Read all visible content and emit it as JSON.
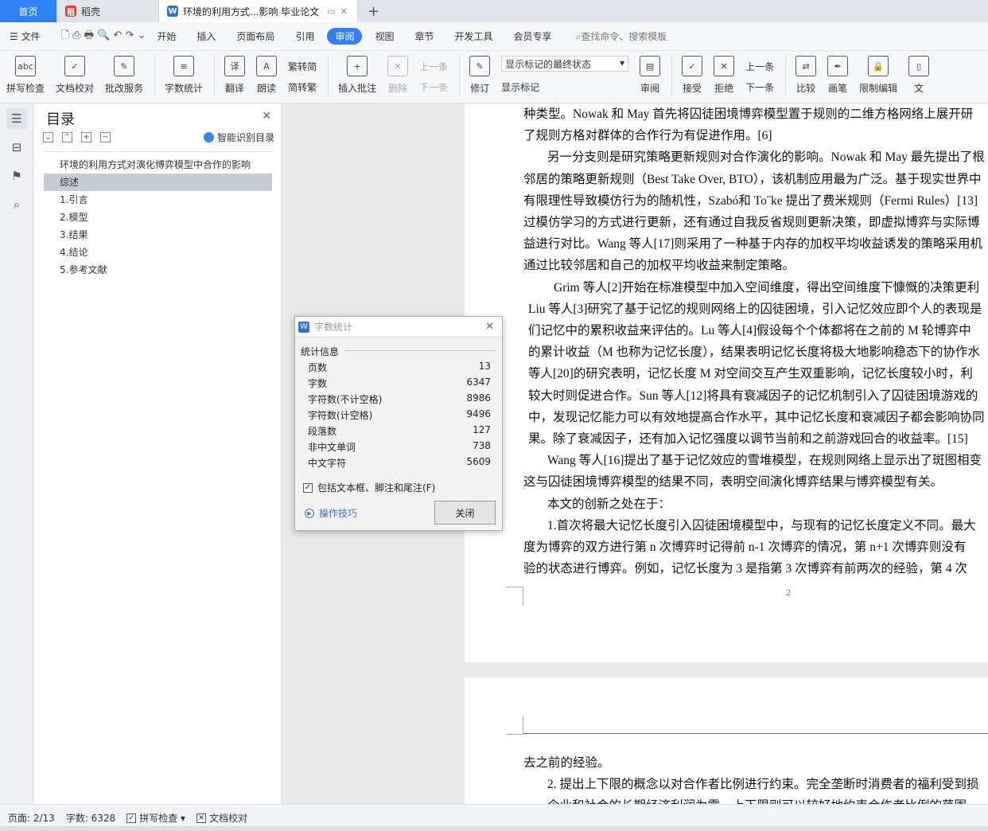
{
  "tabs": {
    "home": "首页",
    "daoke": "稻壳",
    "doc": "环境的利用方式...影响 毕业论文",
    "new": "+"
  },
  "menu": {
    "file": "文件",
    "items": [
      "开始",
      "插入",
      "页面布局",
      "引用",
      "审阅",
      "视图",
      "章节",
      "开发工具",
      "会员专享"
    ],
    "active": "审阅",
    "search": "查找命令、搜索模板"
  },
  "ribbon": {
    "spellcheck": "拼写检查",
    "doccheck": "文档校对",
    "review_service": "批改服务",
    "wordcount": "字数统计",
    "translate": "翻译",
    "read": "朗读",
    "trad_to_simp": "繁转简",
    "simp_to_trad": "简转繁",
    "insert_comment": "插入批注",
    "delete": "删除",
    "prev": "上一条",
    "next": "下一条",
    "revise": "修订",
    "markup_dropdown": "显示标记的最终状态",
    "show_markup": "显示标记",
    "review": "审阅",
    "accept": "接受",
    "reject": "拒绝",
    "prev2": "上一条",
    "next2": "下一条",
    "compare": "比较",
    "pen": "画笔",
    "restrict": "限制编辑",
    "doc": "文"
  },
  "toc": {
    "title": "目录",
    "smart": "智能识别目录",
    "items": [
      "环境的利用方式对演化博弈模型中合作的影响",
      "综述",
      "1.引言",
      "2.模型",
      "3.结果",
      "4.结论",
      "5.参考文献"
    ],
    "selected_index": 1
  },
  "document": {
    "page1_lines": [
      "种类型。Nowak 和 May 首先将囚徒困境博弈模型置于规则的二维方格网络上展开研",
      "了规则方格对群体的合作行为有促进作用。[6]",
      "另一分支则是研究策略更新规则对合作演化的影响。Nowak 和 May 最先提出了根",
      "邻居的策略更新规则（Best Take Over, BTO），该机制应用最为广泛。基于现实世界中",
      "有限理性导致模仿行为的随机性，Szabó和 To˝ke 提出了费米规则（Fermi Rules）[13]",
      "过模仿学习的方式进行更新，还有通过自我反省规则更新决策，即虚拟博弈与实际博",
      "益进行对比。Wang 等人[17]则采用了一种基于内存的加权平均收益诱发的策略采用机",
      "通过比较邻居和自己的加权平均收益来制定策略。",
      "Grim 等人[2]开始在标准模型中加入空间维度，得出空间维度下慷慨的决策更利",
      "Liu 等人[3]研究了基于记忆的规则网络上的囚徒困境，引入记忆效应即个人的表现是",
      "们记忆中的累积收益来评估的。Lu 等人[4]假设每个个体都将在之前的 M 轮博弈中",
      "的累计收益（M 也称为记忆长度），结果表明记忆长度将极大地影响稳态下的协作水",
      "等人[20]的研究表明，记忆长度 M 对空间交互产生双重影响，记忆长度较小时，利",
      "较大时则促进合作。Sun 等人[12]将具有衰减因子的记忆机制引入了囚徒困境游戏的",
      "中，发现记忆能力可以有效地提高合作水平，其中记忆长度和衰减因子都会影响协同",
      "果。除了衰减因子，还有加入记忆强度以调节当前和之前游戏回合的收益率。[15]",
      "Wang 等人[16]提出了基于记忆效应的雪堆模型，在规则网络上显示出了斑图相变",
      "这与囚徒困境博弈模型的结果不同，表明空间演化博弈结果与博弈模型有关。",
      "本文的创新之处在于：",
      "1.首次将最大记忆长度引入囚徒困境模型中，与现有的记忆长度定义不同。最大",
      "度为博弈的双方进行第 n 次博弈时记得前 n-1 次博弈的情况，第 n+1 次博弈则没有",
      "验的状态进行博弈。例如，记忆长度为 3 是指第 3 次博弈有前两次的经验，第 4 次"
    ],
    "page_number": "2",
    "page2_lines": [
      "去之前的经验。",
      "2. 提出上下限的概念以对合作者比例进行约束。完全垄断时消费者的福利受到损",
      "企业和社会的长期经济利润为零，上下限则可以较好地约束合作者比例的范围。"
    ]
  },
  "dialog": {
    "title": "字数统计",
    "section": "统计信息",
    "stats": [
      {
        "label": "页数",
        "value": "13"
      },
      {
        "label": "字数",
        "value": "6347"
      },
      {
        "label": "字符数(不计空格)",
        "value": "8986"
      },
      {
        "label": "字符数(计空格)",
        "value": "9496"
      },
      {
        "label": "段落数",
        "value": "127"
      },
      {
        "label": "非中文单词",
        "value": "738"
      },
      {
        "label": "中文字符",
        "value": "5609"
      }
    ],
    "include_label": "包括文本框、脚注和尾注(F)",
    "include_checked": true,
    "tips": "操作技巧",
    "close": "关闭"
  },
  "status": {
    "page": "页面: 2/13",
    "words": "字数: 6328",
    "spellcheck": "拼写检查",
    "doccheck": "文档校对"
  }
}
